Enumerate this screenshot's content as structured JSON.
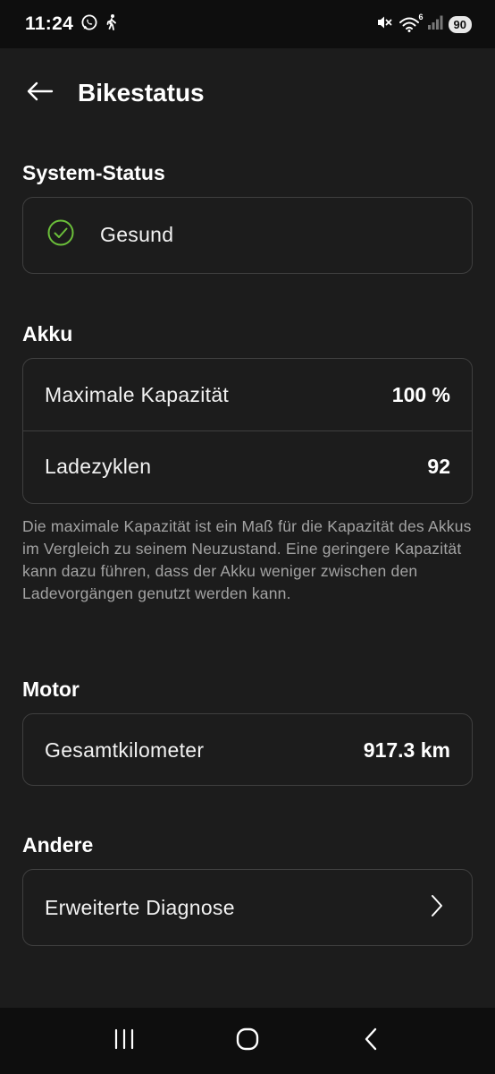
{
  "status_bar": {
    "time": "11:24",
    "battery": "90",
    "wifi_badge": "6",
    "icons": [
      "whatsapp-icon",
      "walking-icon",
      "mute-icon",
      "wifi-icon",
      "signal-icon"
    ]
  },
  "header": {
    "title": "Bikestatus",
    "back_icon": "arrow-left-icon"
  },
  "sections": {
    "system_status": {
      "title": "System-Status",
      "status_label": "Gesund",
      "status_icon": "check-circle-icon",
      "status_color": "#6bbf3a"
    },
    "battery": {
      "title": "Akku",
      "rows": [
        {
          "label": "Maximale Kapazität",
          "value": "100 %"
        },
        {
          "label": "Ladezyklen",
          "value": "92"
        }
      ],
      "hint": "Die maximale Kapazität ist ein Maß für die Kapazität des Akkus im Vergleich zu seinem Neuzustand. Eine geringere Kapazität kann dazu führen, dass der Akku weniger zwischen den Ladevorgängen genutzt werden kann."
    },
    "motor": {
      "title": "Motor",
      "rows": [
        {
          "label": "Gesamtkilometer",
          "value": "917.3 km"
        }
      ]
    },
    "other": {
      "title": "Andere",
      "rows": [
        {
          "label": "Erweiterte Diagnose",
          "icon": "chevron-right-icon"
        }
      ]
    }
  },
  "nav_bar": {
    "icons": [
      "recents-icon",
      "home-icon",
      "back-icon"
    ]
  }
}
